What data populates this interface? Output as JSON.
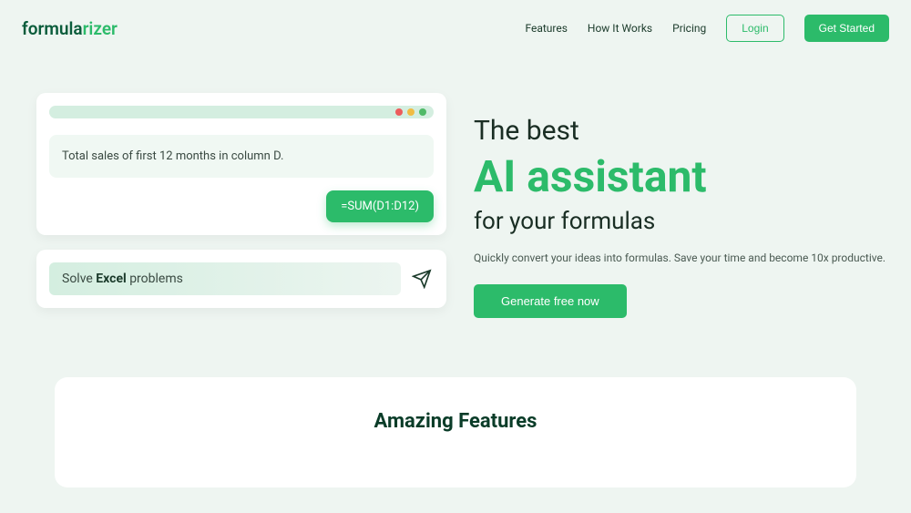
{
  "logo": {
    "part1": "formula",
    "part2": "rizer"
  },
  "nav": {
    "features": "Features",
    "howItWorks": "How It Works",
    "pricing": "Pricing",
    "login": "Login",
    "getStarted": "Get Started"
  },
  "demo": {
    "prompt": "Total sales of first 12 months in column D.",
    "result": "=SUM(D1:D12)"
  },
  "solve": {
    "prefix": "Solve ",
    "highlight": "Excel",
    "suffix": " problems"
  },
  "hero": {
    "line1": "The best",
    "lineAI": "AI assistant",
    "line3": "for your formulas",
    "subtitle": "Quickly convert your ideas into formulas. Save your time and become 10x productive.",
    "cta": "Generate free now"
  },
  "features": {
    "title": "Amazing Features"
  }
}
